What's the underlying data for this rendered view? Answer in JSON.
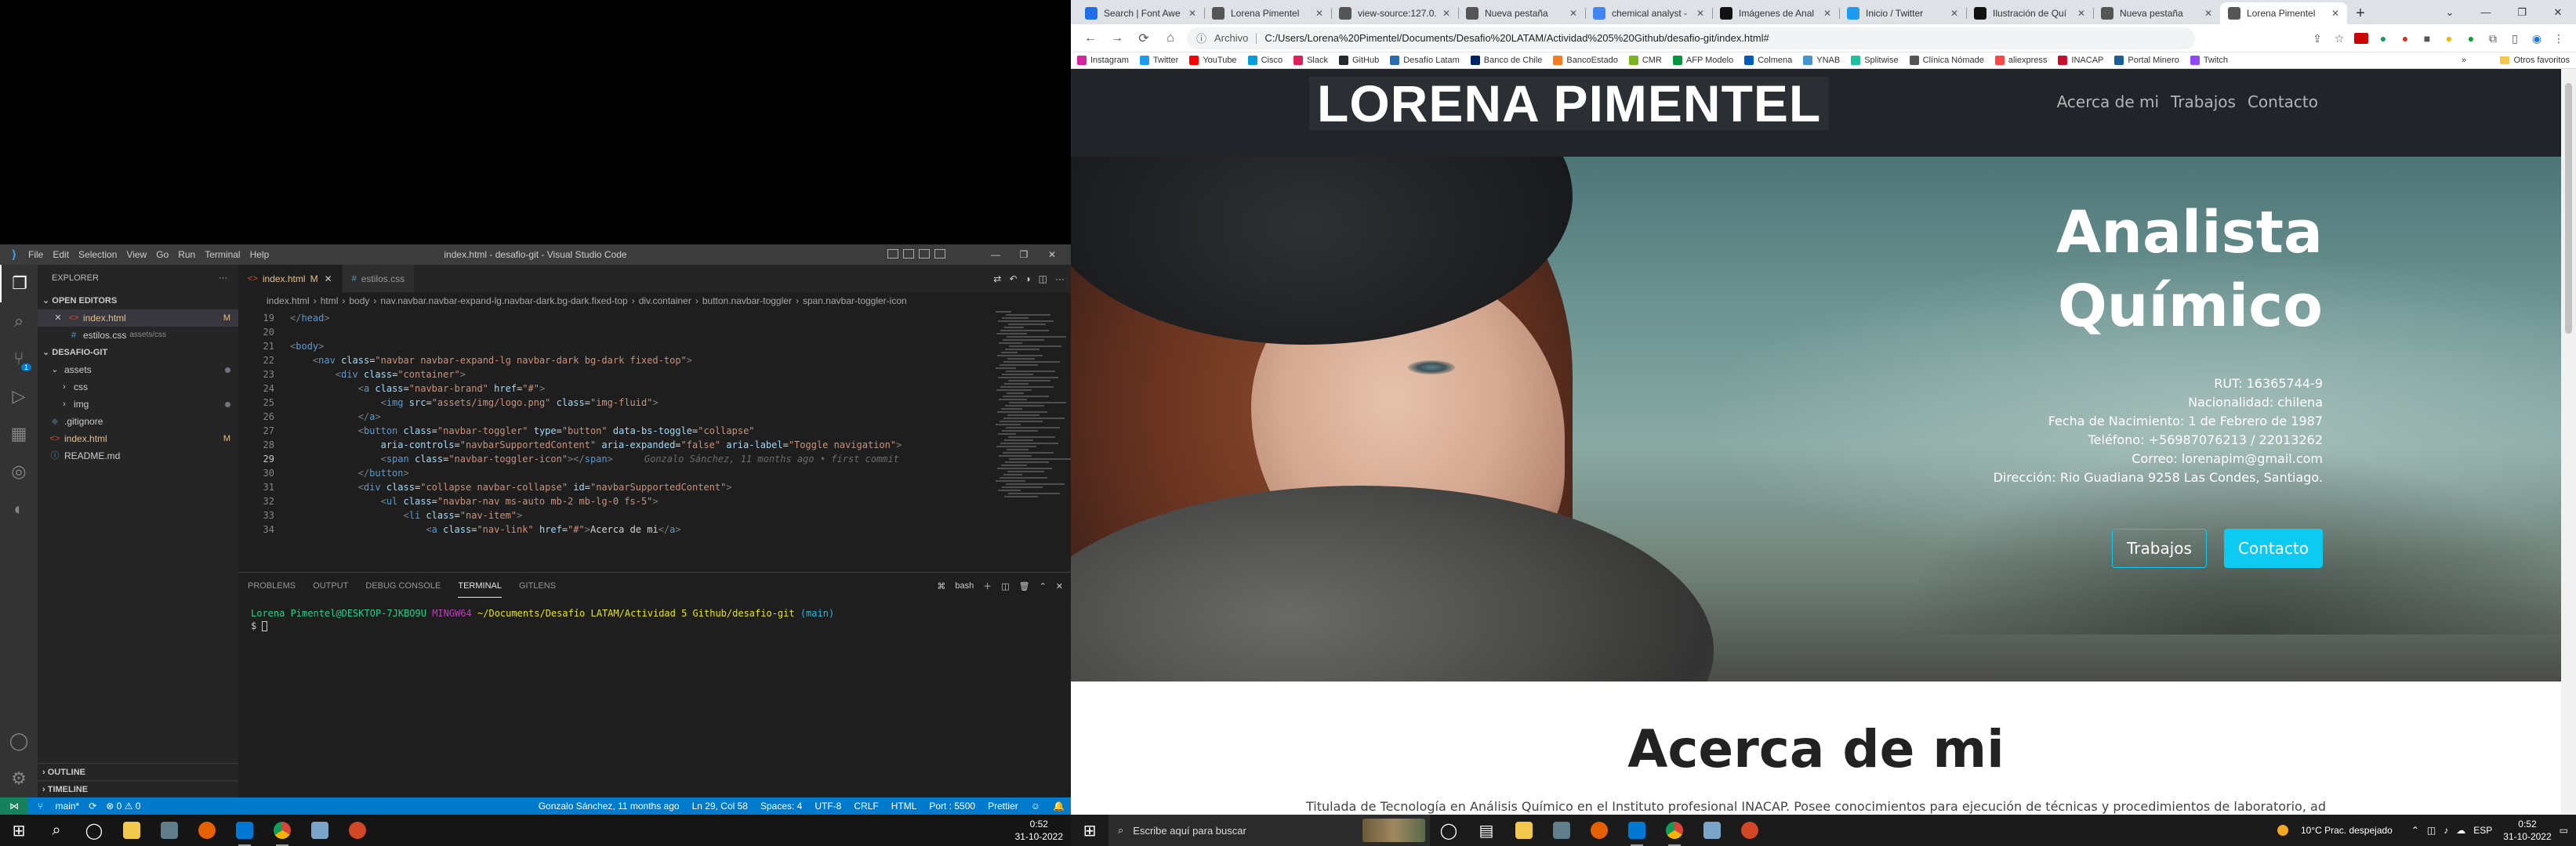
{
  "vscode": {
    "window_title": "index.html - desafio-git - Visual Studio Code",
    "menu": [
      "File",
      "Edit",
      "Selection",
      "View",
      "Go",
      "Run",
      "Terminal",
      "Help"
    ],
    "sidebar": {
      "header": "EXPLORER",
      "open_editors": "OPEN EDITORS",
      "open_items": [
        {
          "name": "index.html",
          "sub": "",
          "status": "M"
        },
        {
          "name": "estilos.css",
          "sub": "assets/css",
          "status": ""
        }
      ],
      "project": "DESAFIO-GIT",
      "tree": [
        {
          "name": "assets",
          "kind": "folder-open",
          "depth": 0
        },
        {
          "name": "css",
          "kind": "folder",
          "depth": 1
        },
        {
          "name": "img",
          "kind": "folder",
          "depth": 1
        },
        {
          "name": ".gitignore",
          "kind": "file",
          "depth": 0
        },
        {
          "name": "index.html",
          "kind": "html",
          "depth": 0,
          "status": "M"
        },
        {
          "name": "README.md",
          "kind": "md",
          "depth": 0
        }
      ],
      "outline": "OUTLINE",
      "timeline": "TIMELINE"
    },
    "tabs": [
      {
        "label": "index.html",
        "status": "M"
      },
      {
        "label": "estilos.css",
        "status": ""
      }
    ],
    "breadcrumb": [
      "index.html",
      "html",
      "body",
      "nav.navbar.navbar-expand-lg.navbar-dark.bg-dark.fixed-top",
      "div.container",
      "button.navbar-toggler",
      "span.navbar-toggler-icon"
    ],
    "code_lines": [
      {
        "n": "19",
        "text": "</head>"
      },
      {
        "n": "20",
        "text": ""
      },
      {
        "n": "21",
        "text": "<body>"
      },
      {
        "n": "22",
        "text": "    <nav class=\"navbar navbar-expand-lg navbar-dark bg-dark fixed-top\">"
      },
      {
        "n": "23",
        "text": "        <div class=\"container\">"
      },
      {
        "n": "24",
        "text": "            <a class=\"navbar-brand\" href=\"#\">"
      },
      {
        "n": "25",
        "text": "                <img src=\"assets/img/logo.png\" class=\"img-fluid\">"
      },
      {
        "n": "26",
        "text": "            </a>"
      },
      {
        "n": "27",
        "text": "            <button class=\"navbar-toggler\" type=\"button\" data-bs-toggle=\"collapse\""
      },
      {
        "n": "28",
        "text": "                aria-controls=\"navbarSupportedContent\" aria-expanded=\"false\" aria-label=\"Toggle navigation\">"
      },
      {
        "n": "29",
        "text": "                <span class=\"navbar-toggler-icon\"></span>"
      },
      {
        "n": "30",
        "text": "            </button>"
      },
      {
        "n": "31",
        "text": "            <div class=\"collapse navbar-collapse\" id=\"navbarSupportedContent\">"
      },
      {
        "n": "32",
        "text": "                <ul class=\"navbar-nav ms-auto mb-2 mb-lg-0 fs-5\">"
      },
      {
        "n": "33",
        "text": "                    <li class=\"nav-item\">"
      },
      {
        "n": "34",
        "text": "                        <a class=\"nav-link\" href=\"#\">Acerca de mi</a>"
      }
    ],
    "git_lens_blame": "Gonzalo Sánchez, 11 months ago • first commit",
    "panel_tabs": [
      "PROBLEMS",
      "OUTPUT",
      "DEBUG CONSOLE",
      "TERMINAL",
      "GITLENS"
    ],
    "panel_shell": "bash",
    "terminal": {
      "user": "Lorena Pimentel@DESKTOP-7JKBO9U",
      "host": "MINGW64",
      "path": "~/Documents/Desafío LATAM/Actividad 5 Github/desafio-git",
      "branch": "(main)",
      "prompt": "$"
    },
    "status": {
      "branch": "main*",
      "problems": "⊗ 0 ⚠ 0",
      "blame": "Gonzalo Sánchez, 11 months ago",
      "position": "Ln 29, Col 58",
      "spaces": "Spaces: 4",
      "encoding": "UTF-8",
      "eol": "CRLF",
      "language": "HTML",
      "port": "Port : 5500",
      "prettier": "Prettier"
    }
  },
  "taskbar_left": {
    "time": "0:52",
    "date": "31-10-2022"
  },
  "browser": {
    "tabs": [
      {
        "label": "Search | Font Awe",
        "color": "#1f6feb",
        "icon": "flag-icon"
      },
      {
        "label": "Lorena Pimentel",
        "color": "#555555",
        "icon": "globe-icon"
      },
      {
        "label": "view-source:127.0.",
        "color": "#555555",
        "icon": "globe-icon"
      },
      {
        "label": "Nueva pestaña",
        "color": "#555555",
        "icon": "globe-icon"
      },
      {
        "label": "chemical analyst -",
        "color": "#4285f4",
        "icon": "google-icon"
      },
      {
        "label": "Imágenes de Anal",
        "color": "#111111",
        "icon": "freepik-icon"
      },
      {
        "label": "Inicio / Twitter",
        "color": "#1d9bf0",
        "icon": "twitter-icon"
      },
      {
        "label": "Ilustración de Quí",
        "color": "#111111",
        "icon": "freepik-icon"
      },
      {
        "label": "Nueva pestaña",
        "color": "#555555",
        "icon": "globe-icon"
      },
      {
        "label": "Lorena Pimentel",
        "color": "#555555",
        "icon": "globe-icon",
        "active": true
      }
    ],
    "address": {
      "scheme": "Archivo",
      "url": "C:/Users/Lorena%20Pimentel/Documents/Desafio%20LATAM/Actividad%205%20Github/desafio-git/index.html#"
    },
    "bookmarks": [
      {
        "label": "Instagram",
        "color": "#d6249f"
      },
      {
        "label": "Twitter",
        "color": "#1d9bf0"
      },
      {
        "label": "YouTube",
        "color": "#ff0000"
      },
      {
        "label": "Cisco",
        "color": "#049fd9"
      },
      {
        "label": "Slack",
        "color": "#e01e5a"
      },
      {
        "label": "GitHub",
        "color": "#24292e"
      },
      {
        "label": "Desafío Latam",
        "color": "#2b6cb0"
      },
      {
        "label": "Banco de Chile",
        "color": "#002464"
      },
      {
        "label": "BancoEstado",
        "color": "#f47b20"
      },
      {
        "label": "CMR",
        "color": "#7ab51d"
      },
      {
        "label": "AFP Modelo",
        "color": "#009640"
      },
      {
        "label": "Colmena",
        "color": "#005eb8"
      },
      {
        "label": "YNAB",
        "color": "#4495d1"
      },
      {
        "label": "Splitwise",
        "color": "#1cc29f"
      },
      {
        "label": "Clínica Nómade",
        "color": "#555555"
      },
      {
        "label": "aliexpress",
        "color": "#ff4747"
      },
      {
        "label": "INACAP",
        "color": "#c8102e"
      },
      {
        "label": "Portal Minero",
        "color": "#1a5e9a"
      },
      {
        "label": "Twitch",
        "color": "#9146ff"
      }
    ],
    "bookmarks_more": "»",
    "other_bookmarks": "Otros favoritos"
  },
  "site": {
    "brand": "LORENA PIMENTEL",
    "nav": [
      "Acerca de mi",
      "Trabajos",
      "Contacto"
    ],
    "hero": {
      "title_line1": "Analista",
      "title_line2": "Químico",
      "info": [
        "RUT: 16365744-9",
        "Nacionalidad: chilena",
        "Fecha de Nacimiento: 1 de Febrero de 1987",
        "Teléfono: +56987076213 / 22013262",
        "Correo: lorenapim@gmail.com",
        "Dirección: Rio Guadiana 9258 Las Condes, Santiago."
      ],
      "btn_works": "Trabajos",
      "btn_contact": "Contacto"
    },
    "about": {
      "title": "Acerca de mi",
      "text": "Titulada de Tecnología en Análisis Químico en el Instituto profesional INACAP. Posee conocimientos para ejecución de técnicas y procedimientos de laboratorio, además de"
    }
  },
  "taskbar_right": {
    "search_placeholder": "Escribe aquí para buscar",
    "weather": "10°C  Prac. despejado",
    "lang": "ESP",
    "time": "0:52",
    "date": "31-10-2022"
  }
}
